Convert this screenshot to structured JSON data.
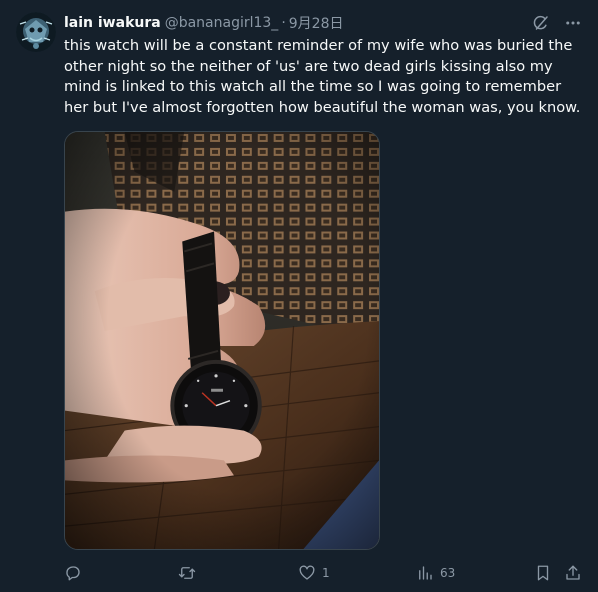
{
  "author": {
    "display_name": "lain iwakura",
    "handle": "@bananagirl13_",
    "separator": "·",
    "date": "9月28日",
    "avatar_icon": "avatar-image"
  },
  "tweet": {
    "text": "this watch will be a constant reminder of my wife who was buried the other night so the neither of 'us' are two dead girls kissing also my mind is linked to this watch all the time so I was going to remember her but I've almost forgotten how beautiful the woman was, you know."
  },
  "media": {
    "kind": "photo",
    "subject_icon": "photo-hand-holding-watch"
  },
  "top_actions": {
    "grok_icon": "grok-icon",
    "more_icon": "more-icon"
  },
  "actions": {
    "reply_icon": "reply-icon",
    "retweet_icon": "retweet-icon",
    "like_icon": "like-icon",
    "like_count": "1",
    "views_icon": "views-icon",
    "views_count": "63",
    "bookmark_icon": "bookmark-icon",
    "share_icon": "share-icon"
  },
  "colors": {
    "background": "#15202b",
    "text_primary": "#f7f9f9",
    "text_secondary": "#8b98a5",
    "border": "#38444d"
  }
}
